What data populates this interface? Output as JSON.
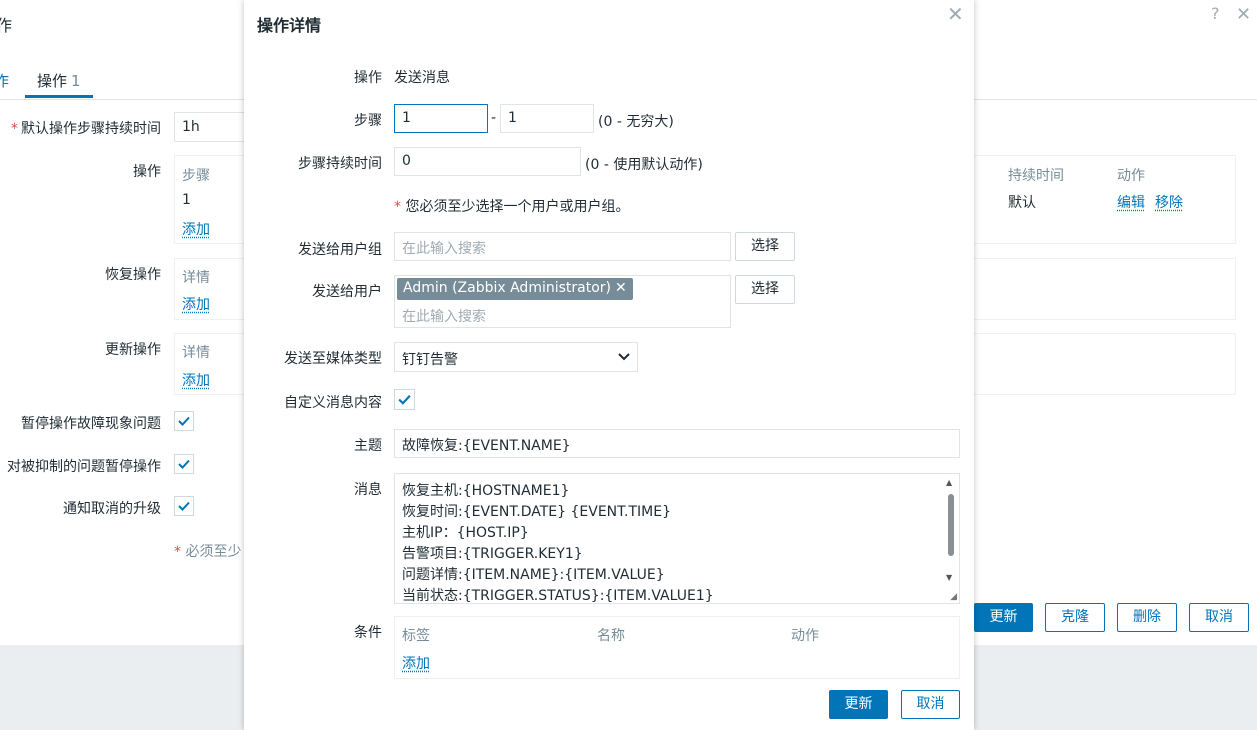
{
  "background": {
    "title_fragment": "作",
    "help_glyph": "?",
    "close_glyph": "✕",
    "tabs": [
      {
        "label": "作"
      },
      {
        "label": "操作",
        "count": "1"
      }
    ],
    "fields": {
      "default_step_duration_label": "默认操作步骤持续时间",
      "default_step_duration_value": "1h",
      "operations_label": "操作",
      "recovery_ops_label": "恢复操作",
      "update_ops_label": "更新操作",
      "pause_symptoms_label": "暂停操作故障现象问题",
      "pause_suppressed_label": "对被抑制的问题暂停操作",
      "notify_cancel_label": "通知取消的升级",
      "required_note": "必须至少"
    },
    "operations_table": {
      "headers": [
        "步骤",
        "持续时间",
        "动作"
      ],
      "row": {
        "step": "1",
        "duration": "默认",
        "edit": "编辑",
        "remove": "移除"
      },
      "add": "添加"
    },
    "recovery_table": {
      "header": "详情",
      "add": "添加"
    },
    "update_table": {
      "header": "详情",
      "add": "添加"
    },
    "buttons": {
      "update": "更新",
      "clone": "克隆",
      "delete": "删除",
      "cancel": "取消"
    },
    "colors": {
      "accent": "#0275b8"
    }
  },
  "dialog": {
    "title": "操作详情",
    "close_glyph": "✕",
    "operation_label": "操作",
    "operation_value": "发送消息",
    "steps_label": "步骤",
    "step_from": "1",
    "step_to": "1",
    "step_sep": "-",
    "steps_hint": "(0 - 无穷大)",
    "step_duration_label": "步骤持续时间",
    "step_duration_value": "0",
    "step_duration_hint": "(0 - 使用默认动作)",
    "required_msg": "您必须至少选择一个用户或用户组。",
    "user_groups_label": "发送给用户组",
    "user_groups_placeholder": "在此输入搜索",
    "select_button": "选择",
    "users_label": "发送给用户",
    "user_tag": "Admin (Zabbix Administrator)",
    "users_placeholder": "在此输入搜索",
    "media_type_label": "发送至媒体类型",
    "media_type_value": "钉钉告警",
    "custom_message_label": "自定义消息内容",
    "custom_message_checked": true,
    "subject_label": "主题",
    "subject_value": "故障恢复:{EVENT.NAME}",
    "message_label": "消息",
    "message_lines": [
      "恢复主机:{HOSTNAME1}",
      "恢复时间:{EVENT.DATE} {EVENT.TIME}",
      "主机IP：{HOST.IP}",
      "告警项目:{TRIGGER.KEY1}",
      "问题详情:{ITEM.NAME}:{ITEM.VALUE}",
      "当前状态:{TRIGGER.STATUS}:{ITEM.VALUE1}"
    ],
    "conditions_label": "条件",
    "conditions_headers": [
      "标签",
      "名称",
      "动作"
    ],
    "conditions_add": "添加",
    "update_button": "更新",
    "cancel_button": "取消"
  }
}
